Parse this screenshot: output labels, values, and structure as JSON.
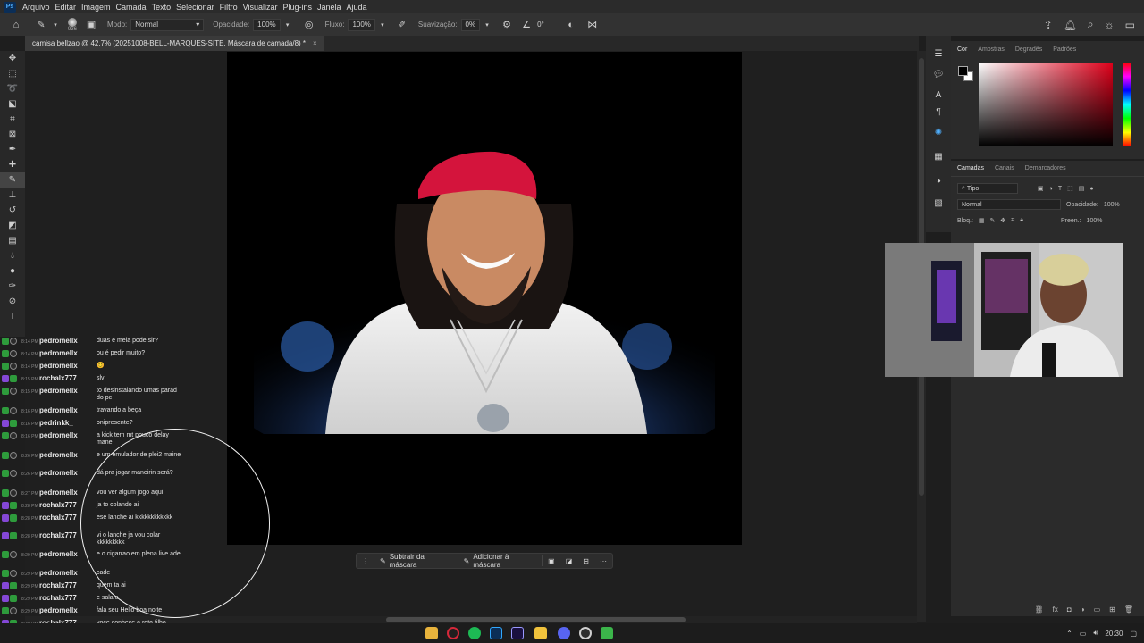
{
  "app": {
    "menu": [
      "Arquivo",
      "Editar",
      "Imagem",
      "Camada",
      "Texto",
      "Selecionar",
      "Filtro",
      "Visualizar",
      "Plug-ins",
      "Janela",
      "Ajuda"
    ],
    "logo_text": "Ps"
  },
  "options": {
    "brush_size": "936",
    "mode_label": "Modo:",
    "mode_value": "Normal",
    "opacity_label": "Opacidade:",
    "opacity_value": "100%",
    "flow_label": "Fluxo:",
    "flow_value": "100%",
    "smoothing_label": "Suavização:",
    "smoothing_value": "0%",
    "angle_value": "0°"
  },
  "document": {
    "tab_title": "camisa bellzao @ 42,7% (20251008-BELL-MARQUES-SITE, Máscara de camada/8) *",
    "close_glyph": "×"
  },
  "context_bar": {
    "subtract_label": "Subtrair da máscara",
    "add_label": "Adicionar à máscara",
    "more_glyph": "···"
  },
  "color_panel": {
    "tabs": [
      "Cor",
      "Amostras",
      "Degradês",
      "Padrões"
    ]
  },
  "layers_panel": {
    "tabs": [
      "Camadas",
      "Canais",
      "Demarcadores"
    ],
    "filter_label": "Tipo",
    "blend_mode": "Normal",
    "opacity_label": "Opacidade:",
    "opacity_value": "100%",
    "lock_label": "Bloq.:",
    "fill_label": "Preen.:",
    "fill_value": "100%"
  },
  "chat": {
    "messages": [
      {
        "time": "8:14 PM",
        "user": "pedromellx",
        "msg": "duas é meia pode sir?",
        "badge": "mod"
      },
      {
        "time": "8:14 PM",
        "user": "pedromellx",
        "msg": "ou é pedir muito?",
        "badge": "mod"
      },
      {
        "time": "8:14 PM",
        "user": "pedromellx",
        "msg": "😊",
        "badge": "mod"
      },
      {
        "time": "8:15 PM",
        "user": "rochalx777",
        "msg": "slv",
        "badge": "sub"
      },
      {
        "time": "8:15 PM",
        "user": "pedromellx",
        "msg": "to desinstalando umas parad do pc",
        "badge": "mod"
      },
      {
        "time": "8:16 PM",
        "user": "pedromellx",
        "msg": "travando a beça",
        "badge": "mod"
      },
      {
        "time": "8:16 PM",
        "user": "pedrinkk_",
        "msg": "onipresente?",
        "badge": "sub"
      },
      {
        "time": "8:16 PM",
        "user": "pedromellx",
        "msg": "a kick tem mt pouco delay mane",
        "badge": "mod"
      },
      {
        "time": "8:26 PM",
        "user": "pedromellx",
        "msg": "e um emulador de plei2 maine",
        "badge": "mod"
      },
      {
        "time": "8:26 PM",
        "user": "pedromellx",
        "msg": "dá pra jogar maneirin será?",
        "badge": "mod"
      },
      {
        "time": "8:27 PM",
        "user": "pedromellx",
        "msg": "vou ver algum jogo aqui",
        "badge": "mod"
      },
      {
        "time": "8:28 PM",
        "user": "rochalx777",
        "msg": "ja to colando ai",
        "badge": "sub"
      },
      {
        "time": "8:28 PM",
        "user": "rochalx777",
        "msg": "ese lanche ai kkkkkkkkkkkk",
        "badge": "sub"
      },
      {
        "time": "8:28 PM",
        "user": "rochalx777",
        "msg": "vi o lanche ja vou colar kkkkkkkkk",
        "badge": "sub"
      },
      {
        "time": "8:29 PM",
        "user": "pedromellx",
        "msg": "e o cigarrao em plena live ade",
        "badge": "mod"
      },
      {
        "time": "8:29 PM",
        "user": "pedromellx",
        "msg": "cade",
        "badge": "mod"
      },
      {
        "time": "8:29 PM",
        "user": "rochalx777",
        "msg": "quem ta ai",
        "badge": "sub"
      },
      {
        "time": "8:29 PM",
        "user": "rochalx777",
        "msg": "e sala e",
        "badge": "sub"
      },
      {
        "time": "8:29 PM",
        "user": "pedromellx",
        "msg": "fala seu Helio boa noite",
        "badge": "mod"
      },
      {
        "time": "8:30 PM",
        "user": "rochalx777",
        "msg": "voce conhece a rota filho kkkkkkkkkkkkk",
        "badge": "sub"
      }
    ]
  },
  "tray": {
    "time": "20:30"
  },
  "colors": {
    "bandana": "#d4143c",
    "mod_badge": "#2e9b3c",
    "sub_badge": "#8447d6"
  }
}
